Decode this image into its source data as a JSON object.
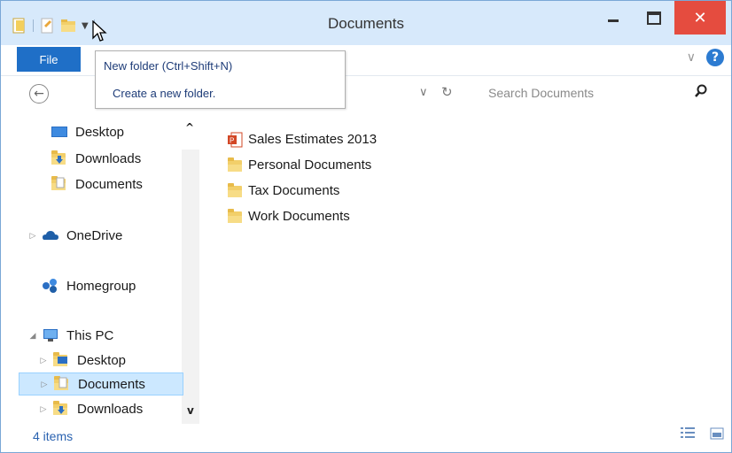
{
  "window": {
    "title": "Documents"
  },
  "title_buttons": {
    "close_glyph": "✕"
  },
  "ribbon": {
    "file_tab": "File",
    "collapse_glyph": "∨",
    "help_glyph": "?"
  },
  "tooltip": {
    "title": "New folder (Ctrl+Shift+N)",
    "description": "Create a new folder."
  },
  "address": {
    "back_glyph": "←",
    "dropdown_glyph": "∨",
    "refresh_glyph": "↻",
    "search_placeholder": "Search Documents"
  },
  "nav": {
    "scroll_up_glyph": "^",
    "scroll_down_glyph": "v",
    "quick_access": [
      {
        "label": "Desktop",
        "icon": "desktop-icon"
      },
      {
        "label": "Downloads",
        "icon": "downloads-folder-icon"
      },
      {
        "label": "Documents",
        "icon": "documents-folder-icon"
      }
    ],
    "onedrive": {
      "label": "OneDrive",
      "icon": "onedrive-icon",
      "expander": "▷"
    },
    "homegroup": {
      "label": "Homegroup",
      "icon": "homegroup-icon"
    },
    "this_pc": {
      "label": "This PC",
      "icon": "computer-icon",
      "expander": "◢",
      "children": [
        {
          "label": "Desktop",
          "icon": "desktop-folder-icon",
          "expander": "▷",
          "selected": false
        },
        {
          "label": "Documents",
          "icon": "documents-folder-icon",
          "expander": "▷",
          "selected": true
        },
        {
          "label": "Downloads",
          "icon": "downloads-folder-icon",
          "expander": "▷",
          "selected": false
        }
      ]
    }
  },
  "files": [
    {
      "name": "Sales Estimates 2013",
      "icon": "powerpoint-file-icon"
    },
    {
      "name": "Personal Documents",
      "icon": "folder-icon"
    },
    {
      "name": "Tax Documents",
      "icon": "folder-icon"
    },
    {
      "name": "Work Documents",
      "icon": "folder-icon"
    }
  ],
  "status": {
    "item_count": "4 items"
  },
  "colors": {
    "accent": "#1f6fc7",
    "titlebar": "#d7e9fb",
    "close": "#e54c3f",
    "selection": "#cce8ff",
    "folder": "#f2cf6a"
  }
}
